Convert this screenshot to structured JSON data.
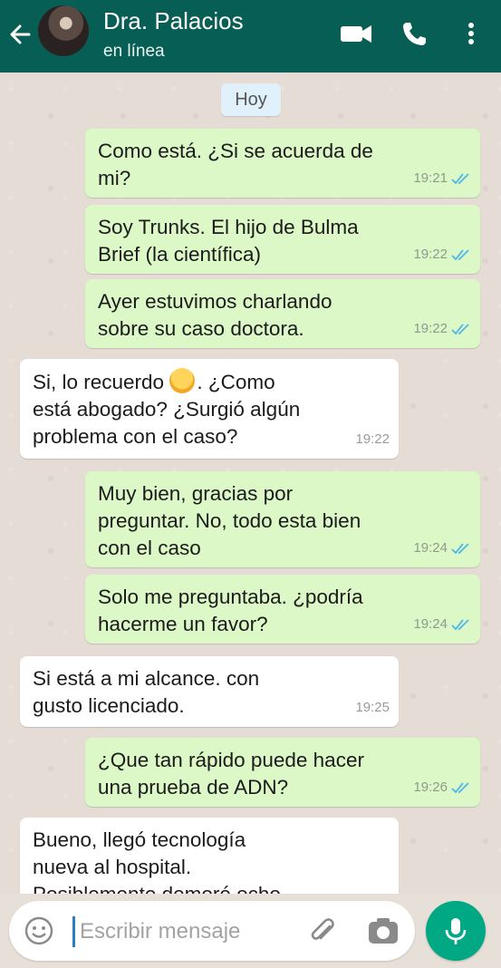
{
  "header": {
    "contact_name": "Dra. Palacios",
    "status": "en línea"
  },
  "chat": {
    "day_label": "Hoy",
    "messages": [
      {
        "direction": "outgoing",
        "text": "Como está. ¿Si se acuerda de\nmi?",
        "time": "19:21",
        "ticks": "read"
      },
      {
        "direction": "outgoing",
        "text": "Soy Trunks. El hijo de Bulma\nBrief (la científica)",
        "time": "19:22",
        "ticks": "read"
      },
      {
        "direction": "outgoing",
        "text": "Ayer estuvimos charlando\nsobre su caso doctora.",
        "time": "19:22",
        "ticks": "read"
      },
      {
        "direction": "incoming",
        "text_before_emoji": "Si, lo recuerdo ",
        "emoji": "smiling-face-emoji",
        "text_after_emoji": ". ¿Como\nestá abogado? ¿Surgió algún\nproblema con el caso?",
        "time": "19:22"
      },
      {
        "direction": "outgoing",
        "text": "Muy bien, gracias por\npreguntar. No, todo esta bien\ncon el caso",
        "time": "19:24",
        "ticks": "read"
      },
      {
        "direction": "outgoing",
        "text": "Solo me preguntaba. ¿podría\nhacerme un favor?",
        "time": "19:24",
        "ticks": "read"
      },
      {
        "direction": "incoming",
        "text": "Si está a mi alcance. con\ngusto licenciado.",
        "time": "19:25"
      },
      {
        "direction": "outgoing",
        "text": "¿Que tan rápido puede hacer\nuna prueba de ADN?",
        "time": "19:26",
        "ticks": "read"
      },
      {
        "direction": "incoming",
        "text": "Bueno, llegó tecnología\nnueva al hospital.\nPosiblemente demoré ocho",
        "time": ""
      }
    ]
  },
  "input": {
    "placeholder": "Escribir mensaje"
  },
  "colors": {
    "header": "#075e54",
    "outgoing_bubble": "#dcf8c6",
    "incoming_bubble": "#ffffff",
    "read_ticks": "#4fb6ec",
    "mic_button": "#00a884"
  },
  "icons": [
    "back-arrow-icon",
    "video-call-icon",
    "phone-icon",
    "more-vert-icon",
    "emoji-icon",
    "attach-icon",
    "camera-icon",
    "mic-icon",
    "double-check-icon"
  ]
}
